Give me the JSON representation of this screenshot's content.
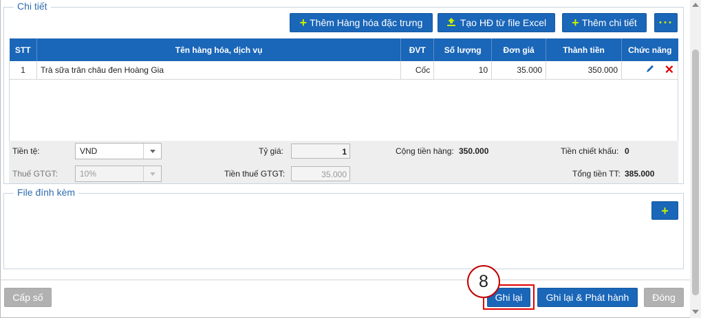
{
  "detail": {
    "legend": "Chi tiết",
    "buttons": {
      "add_featured": "Thêm Hàng hóa đặc trưng",
      "from_excel": "Tạo HĐ từ file Excel",
      "add_detail": "Thêm chi tiết",
      "more": "···"
    },
    "table": {
      "headers": [
        "STT",
        "Tên hàng hóa, dịch vụ",
        "ĐVT",
        "Số lượng",
        "Đơn giá",
        "Thành tiền",
        "Chức năng"
      ],
      "rows": [
        {
          "stt": "1",
          "name": "Trà sữa trân châu đen Hoàng Gia",
          "unit": "Cốc",
          "qty": "10",
          "price": "35.000",
          "amount": "350.000"
        }
      ]
    },
    "summary": {
      "currency_label": "Tiền tệ:",
      "currency_value": "VND",
      "rate_label": "Tỷ giá:",
      "rate_value": "1",
      "goods_total_label": "Cộng tiền hàng:",
      "goods_total_value": "350.000",
      "discount_label": "Tiền chiết khấu:",
      "discount_value": "0",
      "vat_label": "Thuế GTGT:",
      "vat_value": "10%",
      "vat_amount_label": "Tiền thuế GTGT:",
      "vat_amount_value": "35.000",
      "grand_total_label": "Tổng tiền TT:",
      "grand_total_value": "385.000"
    }
  },
  "attachments": {
    "legend": "File đính kèm",
    "add_icon": "plus-icon"
  },
  "footer": {
    "issue_number": "Cấp số",
    "save": "Ghi lại",
    "save_publish": "Ghi lại & Phát hành",
    "close": "Đóng",
    "step_number": "8"
  },
  "colors": {
    "primary": "#1a66b8",
    "accent_plus": "#c7f000",
    "highlight": "#e00000",
    "disabled_button": "#b1b1b1"
  }
}
